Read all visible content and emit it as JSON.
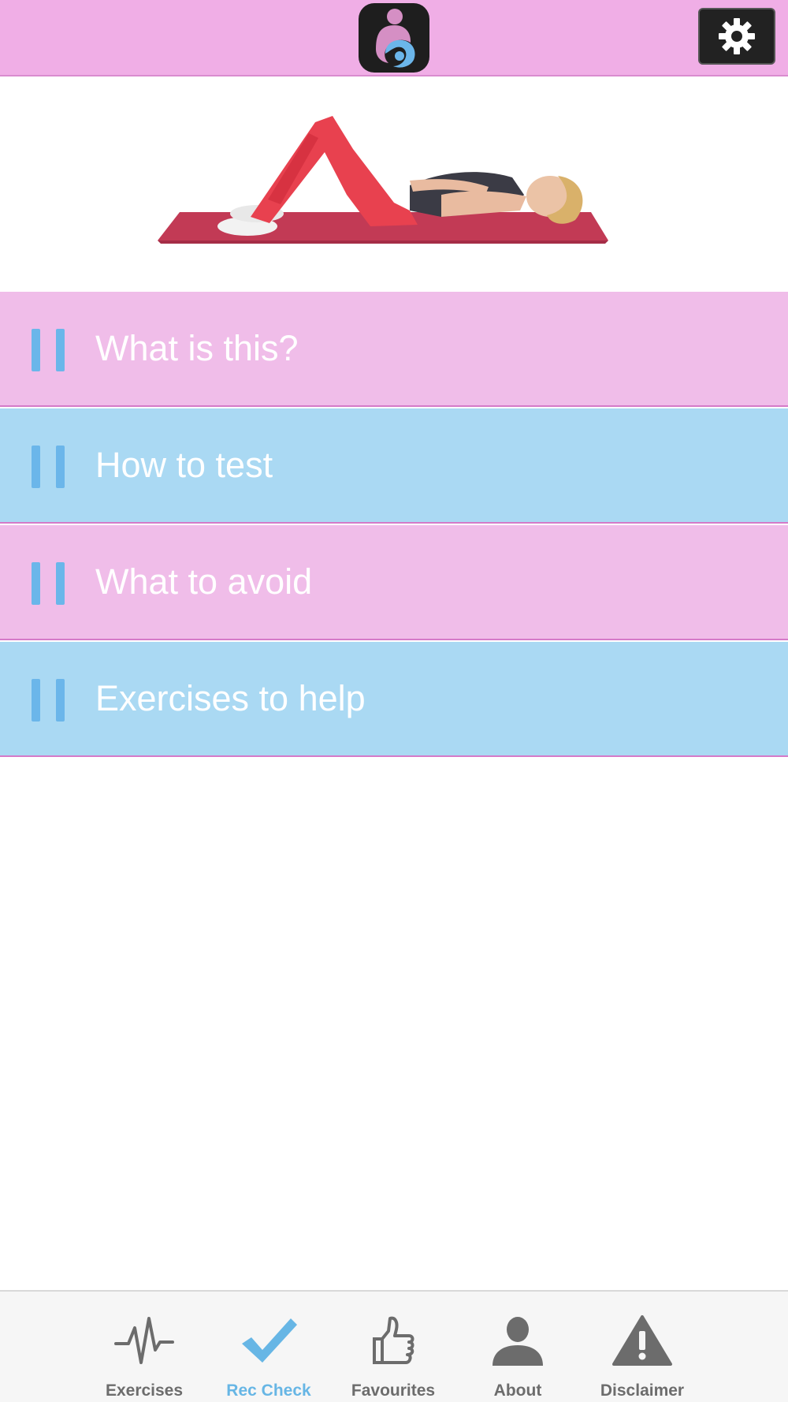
{
  "header": {
    "logo_icon": "mother-and-baby-logo-icon",
    "settings_icon": "gear-icon"
  },
  "hero": {
    "image_description_icon": "woman-lying-on-mat-illustration"
  },
  "menu": {
    "items": [
      {
        "label": "What is this?",
        "style": "pink",
        "icon": "pause-bars-icon"
      },
      {
        "label": "How to test",
        "style": "blue",
        "icon": "pause-bars-icon"
      },
      {
        "label": "What to avoid",
        "style": "pink",
        "icon": "pause-bars-icon"
      },
      {
        "label": "Exercises to help",
        "style": "blue",
        "icon": "pause-bars-icon"
      }
    ]
  },
  "tabbar": {
    "tabs": [
      {
        "label": "Exercises",
        "icon": "heartbeat-icon",
        "active": false
      },
      {
        "label": "Rec Check",
        "icon": "checkmark-icon",
        "active": true
      },
      {
        "label": "Favourites",
        "icon": "thumbs-up-icon",
        "active": false
      },
      {
        "label": "About",
        "icon": "person-icon",
        "active": false
      },
      {
        "label": "Disclaimer",
        "icon": "warning-icon",
        "active": false
      }
    ]
  },
  "colors": {
    "header_bg": "#f0aee6",
    "row_pink": "#f0bde9",
    "row_blue": "#aad9f3",
    "accent_blue": "#67b6e5",
    "tab_inactive": "#6c6c6c"
  }
}
